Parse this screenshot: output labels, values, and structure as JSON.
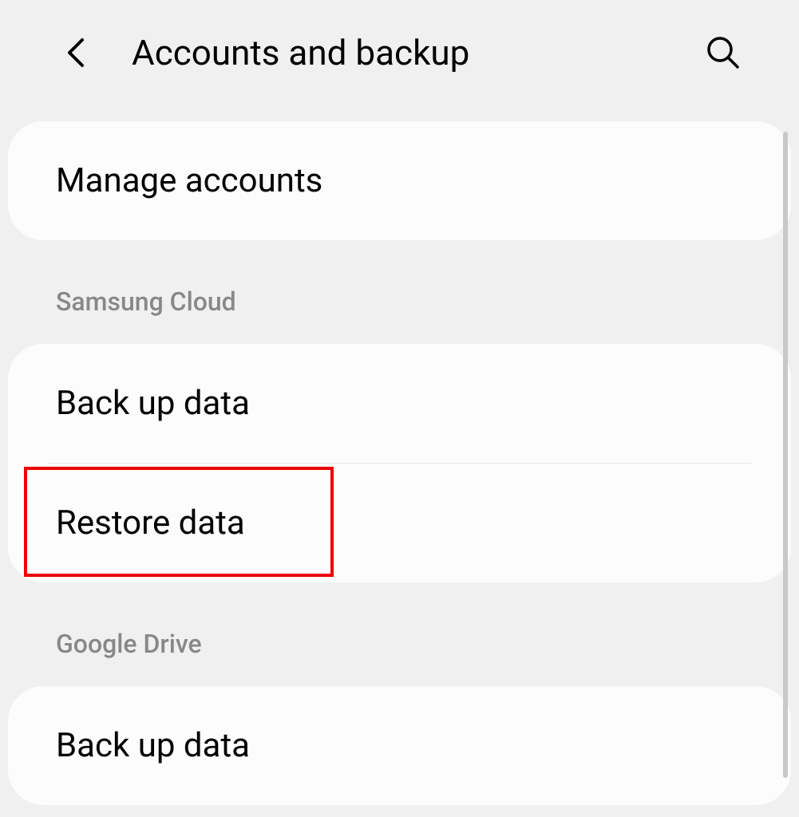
{
  "header": {
    "title": "Accounts and backup"
  },
  "sections": {
    "manage": {
      "items": [
        {
          "label": "Manage accounts"
        }
      ]
    },
    "samsung_cloud": {
      "header": "Samsung Cloud",
      "items": [
        {
          "label": "Back up data"
        },
        {
          "label": "Restore data"
        }
      ]
    },
    "google_drive": {
      "header": "Google Drive",
      "items": [
        {
          "label": "Back up data"
        }
      ]
    }
  }
}
